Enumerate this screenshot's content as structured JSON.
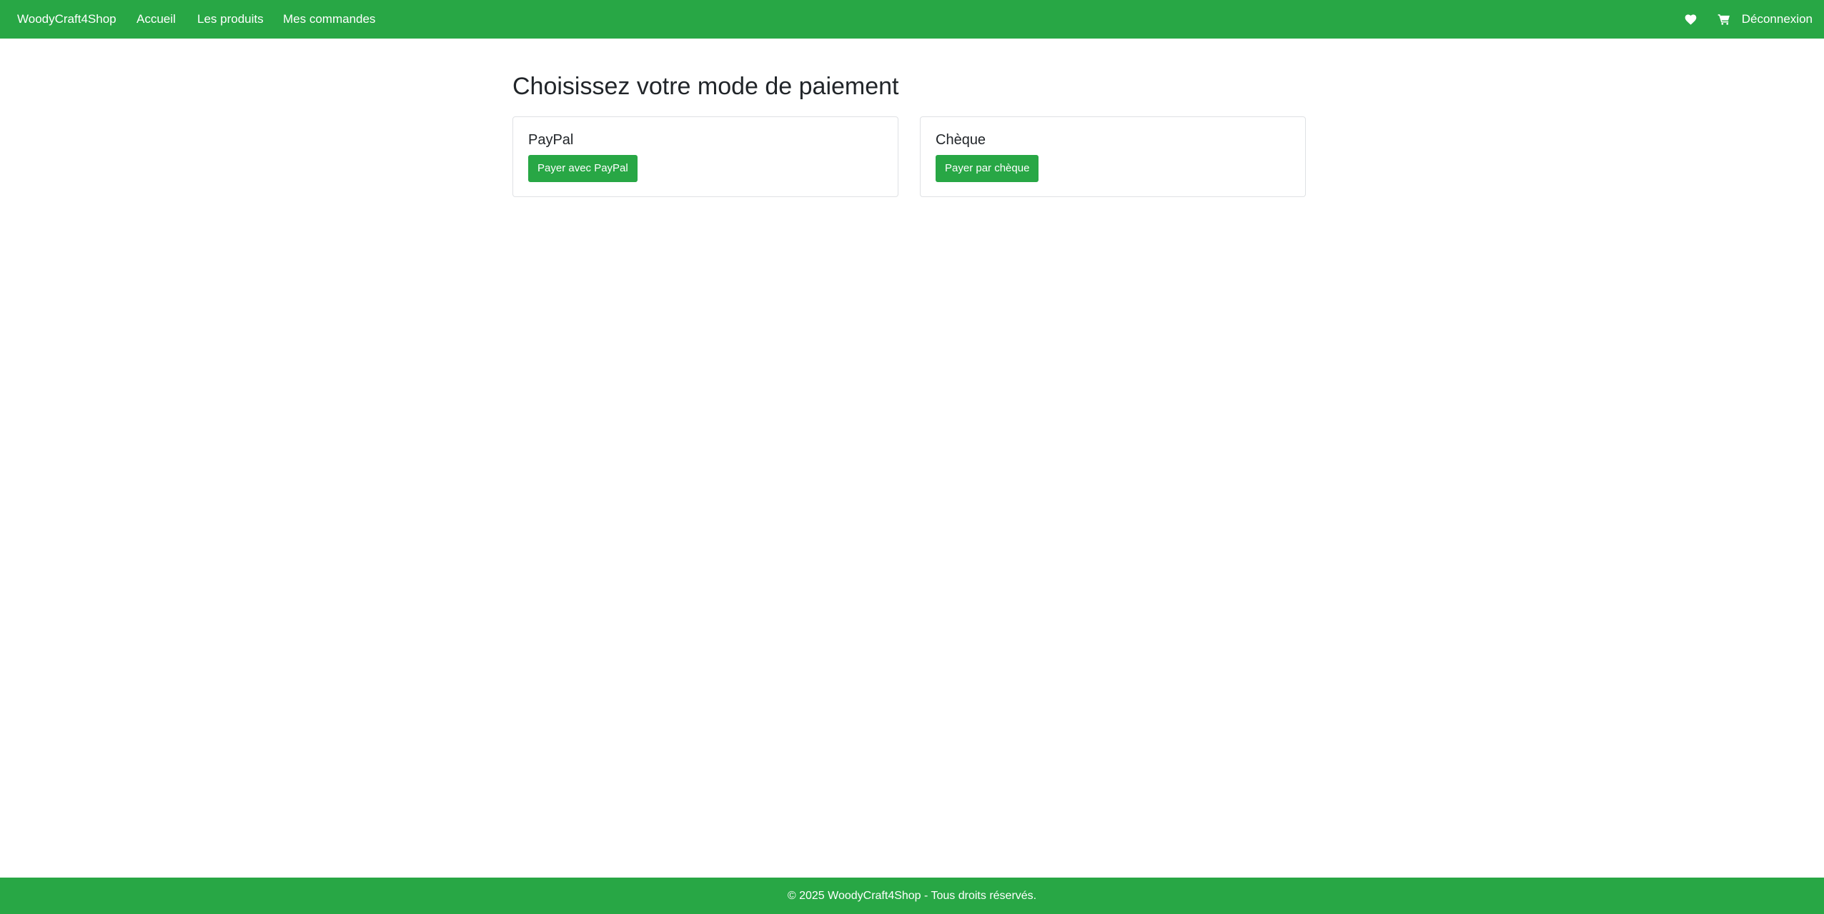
{
  "navbar": {
    "brand": "WoodyCraft4Shop",
    "links": [
      {
        "label": "Accueil"
      },
      {
        "label": "Les produits"
      },
      {
        "label": "Mes commandes"
      }
    ],
    "icons": {
      "favorites": "heart-icon",
      "cart": "cart-icon"
    },
    "logout_label": "Déconnexion"
  },
  "main": {
    "title": "Choisissez votre mode de paiement",
    "payment_methods": [
      {
        "title": "PayPal",
        "button_label": "Payer avec PayPal"
      },
      {
        "title": "Chèque",
        "button_label": "Payer par chèque"
      }
    ]
  },
  "footer": {
    "text": "© 2025 WoodyCraft4Shop - Tous droits réservés."
  },
  "colors": {
    "accent": "#28a745",
    "text": "#212529",
    "card_border": "#dfe1e4"
  }
}
